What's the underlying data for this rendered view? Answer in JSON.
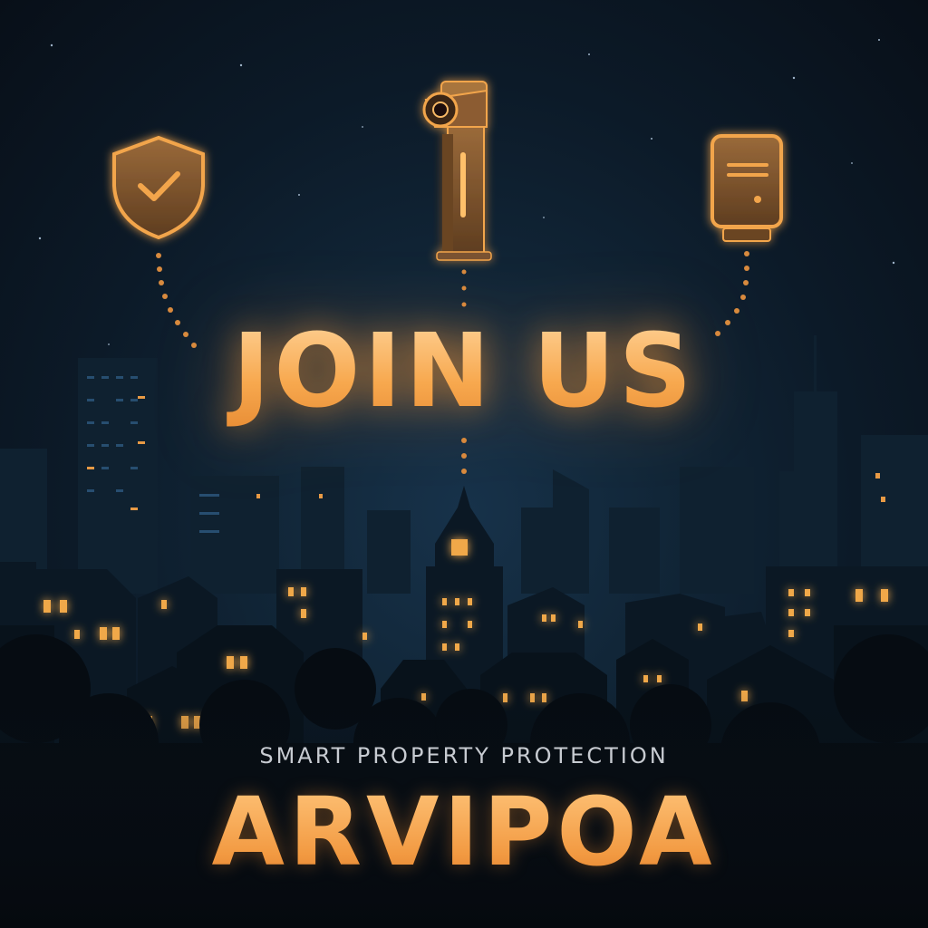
{
  "headline": "JOIN US",
  "tagline": "SMART PROPERTY PROTECTION",
  "brand": "ARVIPOA",
  "icons": [
    "shield-check-icon",
    "security-camera-icon",
    "server-icon"
  ],
  "colors": {
    "accent": "#f5a24a",
    "accent_light": "#ffd49a",
    "sky_dark": "#080f18",
    "sky_mid": "#17324a",
    "window_light": "#f0a84a",
    "tagline": "#c7cbd1"
  }
}
